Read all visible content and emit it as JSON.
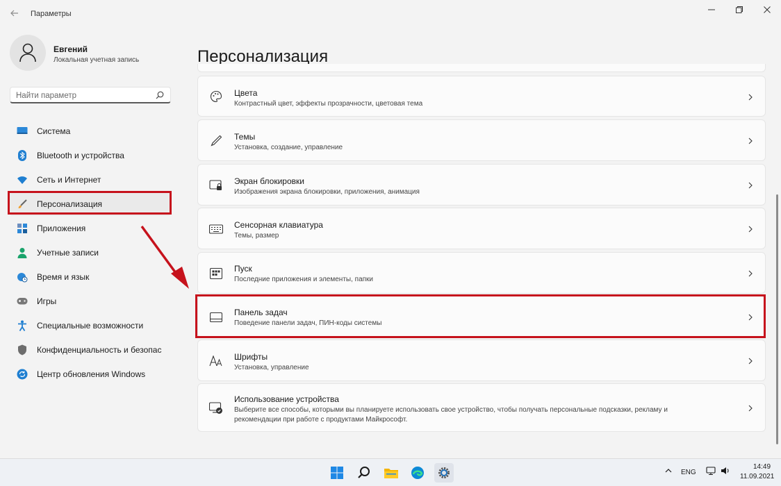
{
  "window": {
    "title": "Параметры",
    "back_icon": "arrow-left-icon",
    "minimize_icon": "minimize-icon",
    "restore_icon": "restore-icon",
    "close_icon": "close-icon"
  },
  "profile": {
    "name": "Евгений",
    "account_type": "Локальная учетная запись"
  },
  "search": {
    "placeholder": "Найти параметр"
  },
  "sidebar": {
    "items": [
      {
        "label": "Система",
        "icon": "monitor-icon"
      },
      {
        "label": "Bluetooth и устройства",
        "icon": "bluetooth-icon"
      },
      {
        "label": "Сеть и Интернет",
        "icon": "wifi-icon"
      },
      {
        "label": "Персонализация",
        "icon": "brush-icon",
        "selected": true
      },
      {
        "label": "Приложения",
        "icon": "apps-icon"
      },
      {
        "label": "Учетные записи",
        "icon": "person-icon"
      },
      {
        "label": "Время и язык",
        "icon": "globe-clock-icon"
      },
      {
        "label": "Игры",
        "icon": "gamepad-icon"
      },
      {
        "label": "Специальные возможности",
        "icon": "accessibility-icon"
      },
      {
        "label": "Конфиденциальность и безопасность",
        "icon": "shield-icon"
      },
      {
        "label": "Центр обновления Windows",
        "icon": "update-icon"
      }
    ]
  },
  "page": {
    "title": "Персонализация"
  },
  "cards": [
    {
      "title": "Цвета",
      "subtitle": "Контрастный цвет, эффекты прозрачности, цветовая тема",
      "icon": "palette-icon"
    },
    {
      "title": "Темы",
      "subtitle": "Установка, создание, управление",
      "icon": "pen-icon"
    },
    {
      "title": "Экран блокировки",
      "subtitle": "Изображения экрана блокировки, приложения, анимация",
      "icon": "lock-screen-icon"
    },
    {
      "title": "Сенсорная клавиатура",
      "subtitle": "Темы, размер",
      "icon": "keyboard-icon"
    },
    {
      "title": "Пуск",
      "subtitle": "Последние приложения и элементы, папки",
      "icon": "start-menu-icon"
    },
    {
      "title": "Панель задач",
      "subtitle": "Поведение панели задач, ПИН-коды системы",
      "icon": "taskbar-icon"
    },
    {
      "title": "Шрифты",
      "subtitle": "Установка, управление",
      "icon": "font-icon"
    },
    {
      "title": "Использование устройства",
      "subtitle": "Выберите все способы, которыми вы планируете использовать свое устройство, чтобы получать персональные подсказки, рекламу и рекомендации при работе с продуктами Майкрософт.",
      "icon": "device-usage-icon"
    }
  ],
  "taskbar": {
    "apps": [
      "windows-start-icon",
      "search-icon",
      "file-explorer-icon",
      "edge-icon",
      "settings-icon"
    ],
    "tray": {
      "language": "ENG",
      "time": "14:49",
      "date": "11.09.2021"
    }
  },
  "colors": {
    "highlight_red": "#c6121c",
    "accent_blue": "#0067c0"
  }
}
